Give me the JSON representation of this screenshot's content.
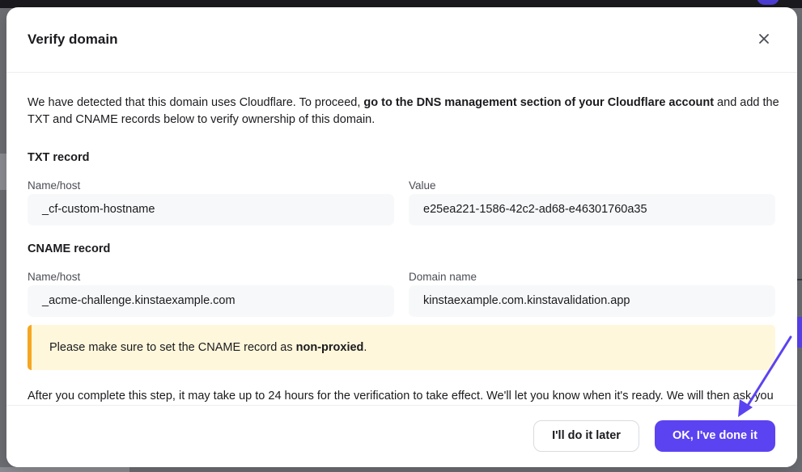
{
  "modal": {
    "title": "Verify domain",
    "intro": {
      "pre": "We have detected that this domain uses Cloudflare. To proceed, ",
      "bold": "go to the DNS management section of your Cloudflare account",
      "post": " and add the TXT and CNAME records below to verify ownership of this domain."
    },
    "txt_record": {
      "title": "TXT record",
      "name_label": "Name/host",
      "name_value": "_cf-custom-hostname",
      "value_label": "Value",
      "value_value": "e25ea221-1586-42c2-ad68-e46301760a35"
    },
    "cname_record": {
      "title": "CNAME record",
      "name_label": "Name/host",
      "name_value": "_acme-challenge.kinstaexample.com",
      "domain_label": "Domain name",
      "domain_value": "kinstaexample.com.kinstavalidation.app"
    },
    "notice": {
      "pre": "Please make sure to set the CNAME record as ",
      "bold": "non-proxied",
      "post": "."
    },
    "after_text": "After you complete this step, it may take up to 24 hours for the verification to take effect. We'll let you know when it's ready. We will then ask you to point your domain to Kinsta.",
    "buttons": {
      "later": "I'll do it later",
      "done": "OK, I've done it"
    }
  },
  "colors": {
    "primary": "#5b43f1",
    "notice_bg": "#fff7db",
    "notice_border": "#f5a623",
    "field_bg": "#f7f8fa",
    "overlay": "#6d6e73"
  },
  "icons": {
    "close": "close-icon",
    "annotation": "arrow-annotation-icon"
  }
}
